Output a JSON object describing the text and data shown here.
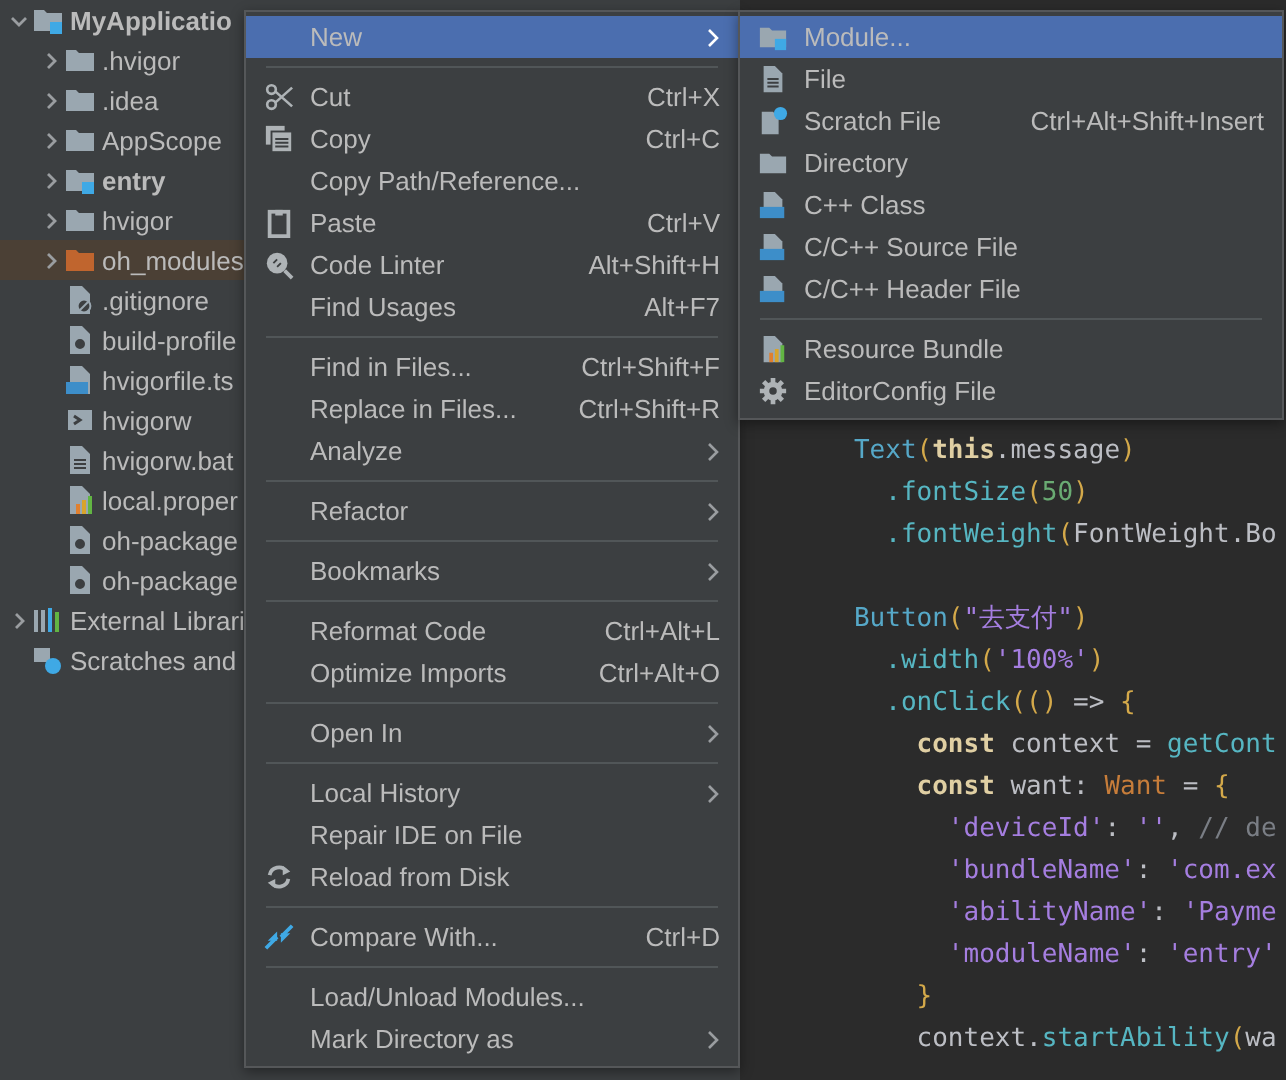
{
  "project_tree": {
    "items": [
      {
        "label": "MyApplicatio",
        "kind": "module",
        "expanded": true,
        "selected": false,
        "children": [
          {
            "label": ".hvigor",
            "kind": "folder",
            "expanded": false,
            "selected": false
          },
          {
            "label": ".idea",
            "kind": "folder",
            "expanded": false,
            "selected": false
          },
          {
            "label": "AppScope",
            "kind": "folder",
            "expanded": false,
            "selected": false
          },
          {
            "label": "entry",
            "kind": "module",
            "expanded": false,
            "selected": false
          },
          {
            "label": "hvigor",
            "kind": "folder",
            "expanded": false,
            "selected": false
          },
          {
            "label": "oh_modules",
            "kind": "excluded",
            "expanded": false,
            "selected": true
          },
          {
            "label": ".gitignore",
            "kind": "ignore",
            "selected": false
          },
          {
            "label": "build-profile",
            "kind": "config",
            "selected": false
          },
          {
            "label": "hvigorfile.ts",
            "kind": "typescript",
            "selected": false
          },
          {
            "label": "hvigorw",
            "kind": "script",
            "selected": false
          },
          {
            "label": "hvigorw.bat",
            "kind": "text",
            "selected": false
          },
          {
            "label": "local.proper",
            "kind": "properties",
            "selected": false
          },
          {
            "label": "oh-package",
            "kind": "config",
            "selected": false
          },
          {
            "label": "oh-package",
            "kind": "config",
            "selected": false
          }
        ]
      },
      {
        "label": "External Librari",
        "kind": "library",
        "expanded": false,
        "selected": false
      },
      {
        "label": "Scratches and",
        "kind": "scratch",
        "selected": false
      }
    ]
  },
  "editor": {
    "lines": [
      [
        {
          "kind": "fn",
          "text": "      Text"
        },
        {
          "kind": "paren",
          "text": "("
        },
        {
          "kind": "kw",
          "text": "this"
        },
        {
          "kind": "plain",
          "text": ".message"
        },
        {
          "kind": "paren",
          "text": ")"
        }
      ],
      [
        {
          "kind": "method",
          "text": "        .fontSize"
        },
        {
          "kind": "paren",
          "text": "("
        },
        {
          "kind": "num",
          "text": "50"
        },
        {
          "kind": "paren",
          "text": ")"
        }
      ],
      [
        {
          "kind": "method",
          "text": "        .fontWeight"
        },
        {
          "kind": "paren",
          "text": "("
        },
        {
          "kind": "plain",
          "text": "FontWeight.Bo"
        }
      ],
      {
        "kind": "blank"
      },
      [
        {
          "kind": "fn",
          "text": "      Button"
        },
        {
          "kind": "paren",
          "text": "("
        },
        {
          "kind": "str",
          "text": "\"去支付\""
        },
        {
          "kind": "paren",
          "text": ")"
        }
      ],
      [
        {
          "kind": "method",
          "text": "        .width"
        },
        {
          "kind": "paren",
          "text": "("
        },
        {
          "kind": "str",
          "text": "'100%'"
        },
        {
          "kind": "paren",
          "text": ")"
        }
      ],
      [
        {
          "kind": "method",
          "text": "        .onClick"
        },
        {
          "kind": "paren",
          "text": "(() "
        },
        {
          "kind": "plain",
          "text": "=> "
        },
        {
          "kind": "paren",
          "text": "{"
        }
      ],
      [
        {
          "kind": "kw",
          "text": "          const "
        },
        {
          "kind": "plain",
          "text": "context = "
        },
        {
          "kind": "method",
          "text": "getCont"
        }
      ],
      [
        {
          "kind": "kw",
          "text": "          const "
        },
        {
          "kind": "plain",
          "text": "want: "
        },
        {
          "kind": "type",
          "text": "Want"
        },
        {
          "kind": "plain",
          "text": " = "
        },
        {
          "kind": "paren",
          "text": "{"
        }
      ],
      [
        {
          "kind": "str",
          "text": "            'deviceId'"
        },
        {
          "kind": "plain",
          "text": ": "
        },
        {
          "kind": "str",
          "text": "''"
        },
        {
          "kind": "plain",
          "text": ", "
        },
        {
          "kind": "comment",
          "text": "// de"
        }
      ],
      [
        {
          "kind": "str",
          "text": "            'bundleName'"
        },
        {
          "kind": "plain",
          "text": ": "
        },
        {
          "kind": "str",
          "text": "'com.ex"
        }
      ],
      [
        {
          "kind": "str",
          "text": "            'abilityName'"
        },
        {
          "kind": "plain",
          "text": ": "
        },
        {
          "kind": "str",
          "text": "'Payme"
        }
      ],
      [
        {
          "kind": "str",
          "text": "            'moduleName'"
        },
        {
          "kind": "plain",
          "text": ": "
        },
        {
          "kind": "str",
          "text": "'entry'"
        }
      ],
      [
        {
          "kind": "paren",
          "text": "          }"
        }
      ],
      [
        {
          "kind": "plain",
          "text": "          context."
        },
        {
          "kind": "method",
          "text": "startAbility"
        },
        {
          "kind": "paren",
          "text": "("
        },
        {
          "kind": "plain",
          "text": "wa"
        }
      ]
    ]
  },
  "context_menu": {
    "items": [
      {
        "kind": "item",
        "label": "New",
        "submenu": true,
        "selected": true
      },
      {
        "kind": "separator"
      },
      {
        "kind": "item",
        "label": "Cut",
        "shortcut": "Ctrl+X",
        "selected": false
      },
      {
        "kind": "item",
        "label": "Copy",
        "shortcut": "Ctrl+C",
        "selected": false
      },
      {
        "kind": "item",
        "label": "Copy Path/Reference...",
        "selected": false
      },
      {
        "kind": "item",
        "label": "Paste",
        "shortcut": "Ctrl+V",
        "selected": false
      },
      {
        "kind": "item",
        "label": "Code Linter",
        "shortcut": "Alt+Shift+H",
        "selected": false
      },
      {
        "kind": "item",
        "label": "Find Usages",
        "shortcut": "Alt+F7",
        "selected": false
      },
      {
        "kind": "separator"
      },
      {
        "kind": "item",
        "label": "Find in Files...",
        "shortcut": "Ctrl+Shift+F",
        "selected": false
      },
      {
        "kind": "item",
        "label": "Replace in Files...",
        "shortcut": "Ctrl+Shift+R",
        "selected": false
      },
      {
        "kind": "item",
        "label": "Analyze",
        "submenu": true,
        "selected": false
      },
      {
        "kind": "separator"
      },
      {
        "kind": "item",
        "label": "Refactor",
        "submenu": true,
        "selected": false
      },
      {
        "kind": "separator"
      },
      {
        "kind": "item",
        "label": "Bookmarks",
        "submenu": true,
        "selected": false
      },
      {
        "kind": "separator"
      },
      {
        "kind": "item",
        "label": "Reformat Code",
        "shortcut": "Ctrl+Alt+L",
        "selected": false
      },
      {
        "kind": "item",
        "label": "Optimize Imports",
        "shortcut": "Ctrl+Alt+O",
        "selected": false
      },
      {
        "kind": "separator"
      },
      {
        "kind": "item",
        "label": "Open In",
        "submenu": true,
        "selected": false
      },
      {
        "kind": "separator"
      },
      {
        "kind": "item",
        "label": "Local History",
        "submenu": true,
        "selected": false
      },
      {
        "kind": "item",
        "label": "Repair IDE on File",
        "selected": false
      },
      {
        "kind": "item",
        "label": "Reload from Disk",
        "selected": false
      },
      {
        "kind": "separator"
      },
      {
        "kind": "item",
        "label": "Compare With...",
        "shortcut": "Ctrl+D",
        "selected": false
      },
      {
        "kind": "separator"
      },
      {
        "kind": "item",
        "label": "Load/Unload Modules...",
        "selected": false
      },
      {
        "kind": "item",
        "label": "Mark Directory as",
        "submenu": true,
        "selected": false
      }
    ]
  },
  "new_submenu": {
    "items": [
      {
        "kind": "item",
        "label": "Module...",
        "selected": true
      },
      {
        "kind": "item",
        "label": "File",
        "selected": false
      },
      {
        "kind": "item",
        "label": "Scratch File",
        "shortcut": "Ctrl+Alt+Shift+Insert",
        "selected": false
      },
      {
        "kind": "item",
        "label": "Directory",
        "selected": false
      },
      {
        "kind": "item",
        "label": "C++ Class",
        "selected": false
      },
      {
        "kind": "item",
        "label": "C/C++ Source File",
        "selected": false
      },
      {
        "kind": "item",
        "label": "C/C++ Header File",
        "selected": false
      },
      {
        "kind": "separator"
      },
      {
        "kind": "item",
        "label": "Resource Bundle",
        "selected": false
      },
      {
        "kind": "item",
        "label": "EditorConfig File",
        "selected": false
      }
    ]
  }
}
